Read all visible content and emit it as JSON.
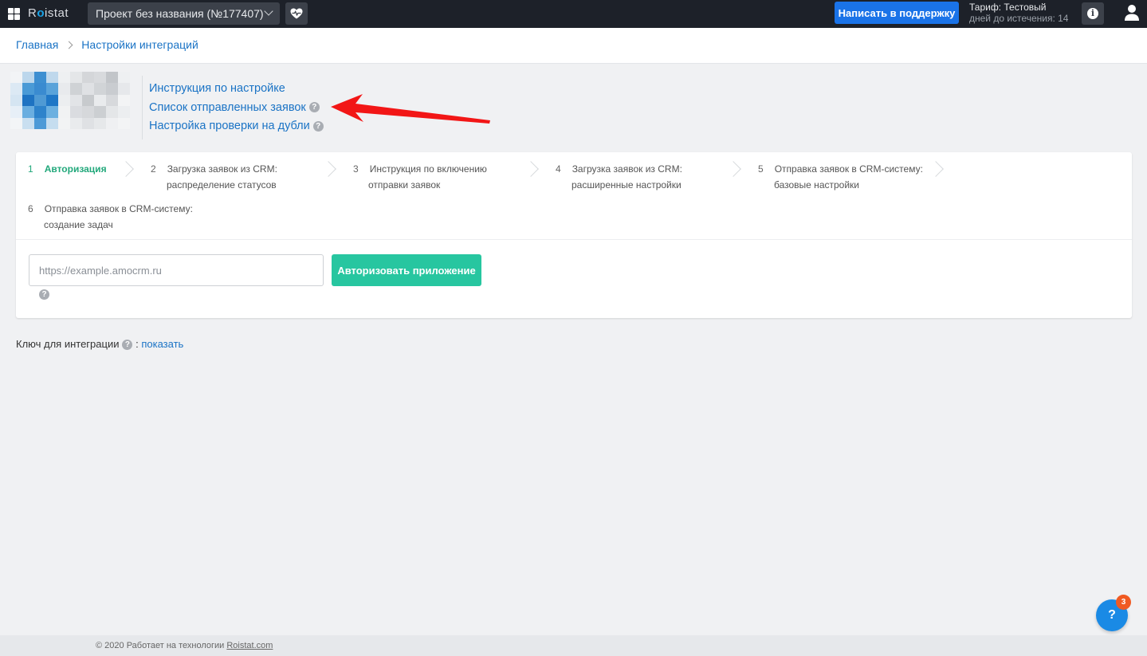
{
  "topbar": {
    "logo_prefix": "R",
    "logo_o": "o",
    "logo_suffix": "istat",
    "project_name": "Проект без названия (№177407)",
    "support_label": "Написать в поддержку",
    "tariff_label": "Тариф: Тестовый",
    "tariff_days": "дней до истечения: 14",
    "info_glyph": "i",
    "accent_color": "#1a73e8"
  },
  "breadcrumb": {
    "items": [
      "Главная",
      "Настройки интеграций"
    ]
  },
  "integration_links": {
    "instruction": "Инструкция по настройке",
    "sent_requests": "Список отправленных заявок",
    "duplicates": "Настройка проверки на дубли"
  },
  "steps": [
    {
      "num": "1",
      "line1": "Авторизация",
      "line2": ""
    },
    {
      "num": "2",
      "line1": "Загрузка заявок из CRM:",
      "line2": "распределение статусов"
    },
    {
      "num": "3",
      "line1": "Инструкция по включению",
      "line2": "отправки заявок"
    },
    {
      "num": "4",
      "line1": "Загрузка заявок из CRM:",
      "line2": "расширенные настройки"
    },
    {
      "num": "5",
      "line1": "Отправка заявок в CRM-систему:",
      "line2": "базовые настройки"
    },
    {
      "num": "6",
      "line1": "Отправка заявок в CRM-систему:",
      "line2": "создание задач"
    }
  ],
  "auth_form": {
    "url_placeholder": "https://example.amocrm.ru",
    "url_value": "",
    "button_label": "Авторизовать приложение",
    "button_color": "#27c6a0"
  },
  "integration_key": {
    "label": "Ключ для интеграции",
    "separator": ":",
    "show_link": "показать"
  },
  "help": {
    "glyph": "?",
    "badge_count": "3"
  },
  "footer": {
    "text": "© 2020 Работает на технологии ",
    "link": "Roistat.com"
  }
}
